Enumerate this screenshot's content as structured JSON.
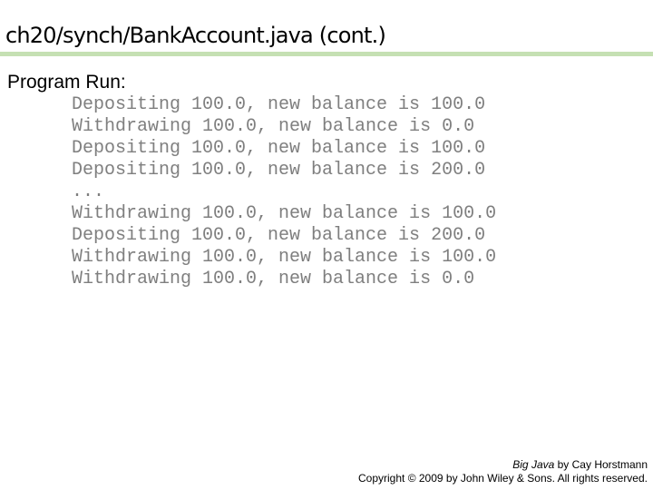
{
  "slide": {
    "title": "ch20/synch/BankAccount.java (cont.)",
    "section_label": "Program Run:",
    "output_lines": [
      "Depositing 100.0, new balance is 100.0",
      "Withdrawing 100.0, new balance is 0.0",
      "Depositing 100.0, new balance is 100.0",
      "Depositing 100.0, new balance is 200.0",
      "...",
      "Withdrawing 100.0, new balance is 100.0",
      "Depositing 100.0, new balance is 200.0",
      "Withdrawing 100.0, new balance is 100.0",
      "Withdrawing 100.0, new balance is 0.0"
    ],
    "colors": {
      "rule": "#c5e0b3",
      "output_text": "#7f7f7f"
    }
  },
  "footer": {
    "book_title": "Big Java",
    "byline": " by Cay Horstmann",
    "copyright": "Copyright © 2009 by John Wiley & Sons.  All rights reserved."
  }
}
